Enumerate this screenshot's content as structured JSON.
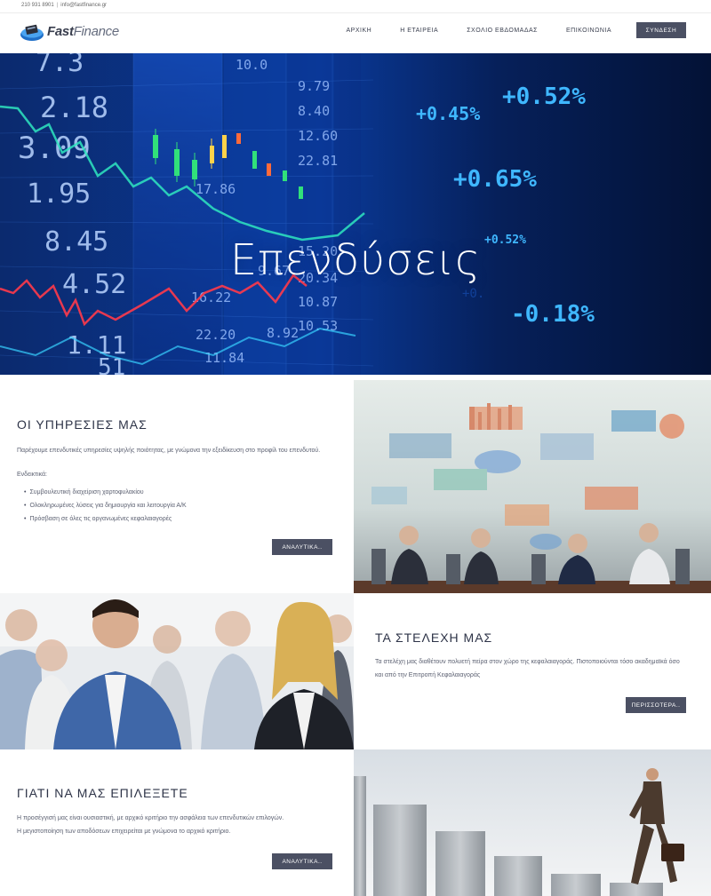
{
  "topbar": {
    "phone": "210 931 8901",
    "email": "info@fastfinance.gr"
  },
  "header": {
    "logo_main": "Fast",
    "logo_sub": "Finance",
    "nav": [
      "ΑΡΧΙΚΗ",
      "Η ΕΤΑΙΡΕΙΑ",
      "ΣΧΟΛΙΟ ΕΒΔΟΜΑΔΑΣ",
      "ΕΠΙΚΟΙΝΩΝΙΑ"
    ],
    "login": "ΣΥΝΔΕΣΗ"
  },
  "hero": {
    "title": "Επενδύσεις",
    "ticker_left": [
      "7.3",
      "2.18",
      "3.09",
      "1.95",
      "8.45",
      "4.52",
      "1.11",
      "51"
    ],
    "ticker_mid": [
      "10.0",
      "9.79",
      "8.40",
      "12.60",
      "22.81",
      "17.86",
      "15.20",
      "20.34",
      "10.87",
      "10.53",
      "16.22",
      "9.67",
      "8.92",
      "22.20",
      "11.84"
    ],
    "ticker_right": [
      "+0.45%",
      "+0.52%",
      "+0.65%",
      "+0.52%",
      "-0.18%"
    ]
  },
  "services": {
    "title": "ΟΙ ΥΠΗΡΕΣΙΕΣ ΜΑΣ",
    "intro": "Παρέχουμε επενδυτικές υπηρεσίες υψηλής ποιότητας, με γνώμονα την εξειδίκευση στο προφίλ του επενδυτού.",
    "indicative": "Ενδεικτικά:",
    "items": [
      "Συμβουλευτική διαχείριση χαρτοφυλακίου",
      "Ολοκληρωμένες λύσεις για δημιουργία και λειτουργία Α/Κ",
      "Πρόσβαση σε όλες τις οργανωμένες κεφαλαιαγορές"
    ],
    "button": "ΑΝΑΛΥΤΙΚΑ.."
  },
  "team": {
    "title": "ΤΑ ΣΤΕΛΕΧΗ ΜΑΣ",
    "text": "Τα στελέχη μας διαθέτουν πολυετή πείρα στον χώρο της κεφαλαιαγοράς. Πιστοποιούνται τόσο ακαδημαϊκά όσο και από την Επιτροπή Κεφαλαιαγοράς",
    "button": "ΠΕΡΙΣΣΟΤΕΡΑ.."
  },
  "why": {
    "title": "ΓΙΑΤΙ ΝΑ ΜΑΣ ΕΠΙΛΕΞΕΤΕ",
    "line1": "Η προσέγγισή μας είναι ουσιαστική, με αρχικό κριτήριο την ασφάλεια των επενδυτικών επιλογών.",
    "line2": "Η μεγιστοποίηση των αποδόσεων επιχειρείται με γνώμονα το αρχικό κριτήριο.",
    "button": "ΑΝΑΛΥΤΙΚΑ.."
  },
  "colors": {
    "button": "#4b5063",
    "heading": "#2e3448",
    "hero_bg": "#051a4a",
    "ticker_green": "#21d28a",
    "ticker_blue": "#3fb7ff"
  }
}
